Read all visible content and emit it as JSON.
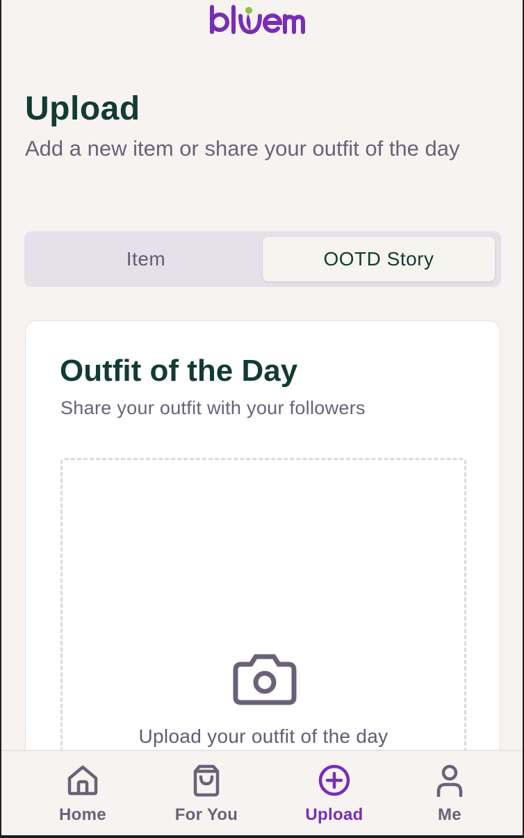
{
  "app": {
    "logo_text": "bloem",
    "brand_color": "#7a2cb8",
    "accent_leaf_color": "#8cc04b"
  },
  "header": {
    "title": "Upload",
    "subtitle": "Add a new item or share your outfit of the day"
  },
  "tabs": [
    {
      "label": "Item",
      "selected": false
    },
    {
      "label": "OOTD Story",
      "selected": true
    }
  ],
  "card": {
    "title": "Outfit of the Day",
    "subtitle": "Share your outfit with your followers",
    "dropzone": {
      "icon": "camera-icon",
      "label": "Upload your outfit of the day"
    }
  },
  "bottom_nav": [
    {
      "label": "Home",
      "icon": "home-icon",
      "active": false
    },
    {
      "label": "For You",
      "icon": "shopping-bag-icon",
      "active": false
    },
    {
      "label": "Upload",
      "icon": "plus-circle-icon",
      "active": true
    },
    {
      "label": "Me",
      "icon": "user-icon",
      "active": false
    }
  ],
  "colors": {
    "background": "#f6f3f0",
    "heading": "#123b34",
    "muted_text": "#6a6179",
    "segment_bg": "#e5e1ea",
    "active_nav": "#7a2cb8"
  }
}
